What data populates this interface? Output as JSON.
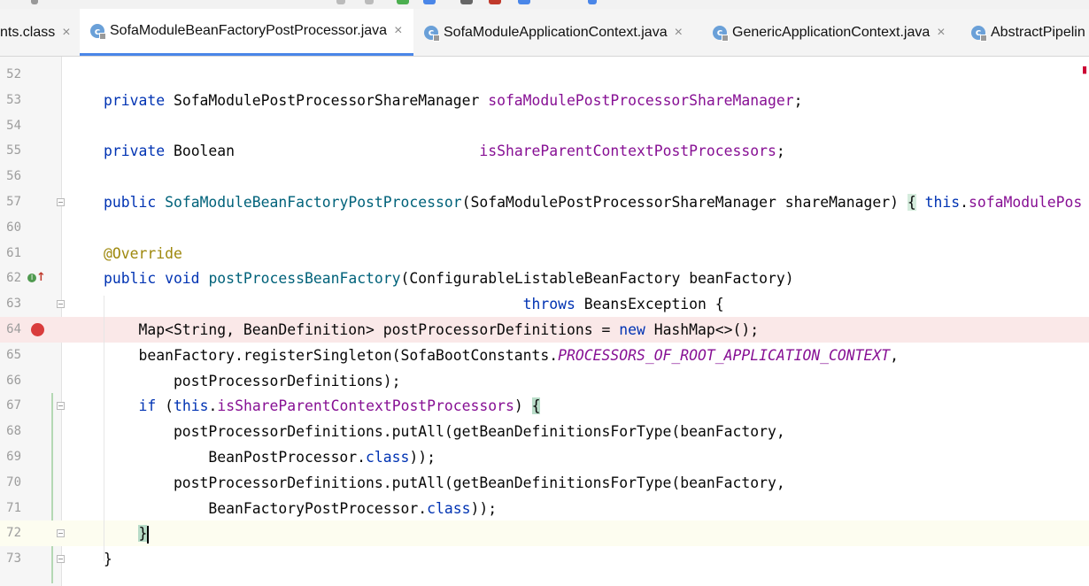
{
  "tabs": [
    {
      "label": "nts.class",
      "active": false,
      "has_icon": false
    },
    {
      "label": "SofaModuleBeanFactoryPostProcessor.java",
      "active": true,
      "has_icon": true
    },
    {
      "label": "SofaModuleApplicationContext.java",
      "active": false,
      "has_icon": true
    },
    {
      "label": "GenericApplicationContext.java",
      "active": false,
      "has_icon": true
    },
    {
      "label": "AbstractPipelin",
      "active": false,
      "has_icon": true
    }
  ],
  "tab_close_glyph": "×",
  "tab_icon_letter": "c",
  "lines": [
    {
      "num": "52",
      "tokens": []
    },
    {
      "num": "53",
      "tokens": [
        [
          "kw",
          "private"
        ],
        [
          "",
          "SofaModulePostProcessorShareManager "
        ],
        [
          "fld",
          "sofaModulePostProcessorShareManager"
        ],
        [
          "",
          ";"
        ]
      ]
    },
    {
      "num": "54",
      "tokens": []
    },
    {
      "num": "55",
      "tokens": [
        [
          "kw",
          "private"
        ],
        [
          "",
          "Boolean                            "
        ],
        [
          "fld",
          "isShareParentContextPostProcessors"
        ],
        [
          "",
          ";"
        ]
      ]
    },
    {
      "num": "56",
      "tokens": []
    },
    {
      "num": "57",
      "tokens": [
        [
          "kw",
          "public"
        ],
        [
          "mth",
          "SofaModuleBeanFactoryPostProcessor"
        ],
        [
          "",
          "(SofaModulePostProcessorShareManager shareManager) "
        ],
        [
          "brace",
          "{"
        ],
        [
          "",
          " "
        ],
        [
          "kw",
          "this"
        ],
        [
          "",
          "."
        ],
        [
          "fld",
          "sofaModulePos"
        ]
      ]
    },
    {
      "num": "60",
      "tokens": []
    },
    {
      "num": "61",
      "tokens": [
        [
          "anno",
          "@Override"
        ]
      ]
    },
    {
      "num": "62",
      "tokens": [
        [
          "kw",
          "public void"
        ],
        [
          "mth",
          "postProcessBeanFactory"
        ],
        [
          "",
          "(ConfigurableListableBeanFactory beanFactory)"
        ]
      ]
    },
    {
      "num": "63",
      "tokens": [
        [
          "",
          "                                                "
        ],
        [
          "kw",
          "throws"
        ],
        [
          "",
          " BeansException {"
        ]
      ]
    },
    {
      "num": "64",
      "tokens": [
        [
          "",
          "    Map<String, BeanDefinition> postProcessorDefinitions = "
        ],
        [
          "kw",
          "new"
        ],
        [
          "",
          " HashMap<>();"
        ]
      ]
    },
    {
      "num": "65",
      "tokens": [
        [
          "",
          "    beanFactory.registerSingleton(SofaBootConstants."
        ],
        [
          "stat",
          "PROCESSORS_OF_ROOT_APPLICATION_CONTEXT"
        ],
        [
          "",
          ","
        ]
      ]
    },
    {
      "num": "66",
      "tokens": [
        [
          "",
          "        postProcessorDefinitions);"
        ]
      ]
    },
    {
      "num": "67",
      "tokens": [
        [
          "",
          "    "
        ],
        [
          "kw",
          "if"
        ],
        [
          "",
          " ("
        ],
        [
          "kw",
          "this"
        ],
        [
          "",
          "."
        ],
        [
          "fld",
          "isShareParentContextPostProcessors"
        ],
        [
          "",
          ") "
        ],
        [
          "brace2",
          "{"
        ]
      ]
    },
    {
      "num": "68",
      "tokens": [
        [
          "",
          "        postProcessorDefinitions.putAll(getBeanDefinitionsForType(beanFactory,"
        ]
      ]
    },
    {
      "num": "69",
      "tokens": [
        [
          "",
          "            BeanPostProcessor."
        ],
        [
          "kw",
          "class"
        ],
        [
          "",
          "));"
        ]
      ]
    },
    {
      "num": "70",
      "tokens": [
        [
          "",
          "        postProcessorDefinitions.putAll(getBeanDefinitionsForType(beanFactory,"
        ]
      ]
    },
    {
      "num": "71",
      "tokens": [
        [
          "",
          "            BeanFactoryPostProcessor."
        ],
        [
          "kw",
          "class"
        ],
        [
          "",
          "));"
        ]
      ]
    },
    {
      "num": "72",
      "tokens": [
        [
          "",
          "    "
        ],
        [
          "brace2",
          "}"
        ],
        [
          "caret",
          ""
        ]
      ]
    },
    {
      "num": "73",
      "tokens": [
        [
          "",
          "}"
        ]
      ]
    }
  ],
  "colors": {
    "keyword": "#0033b3",
    "field": "#871094",
    "annotation": "#9e880d",
    "method": "#00627a",
    "breakpoint": "#d93c3c",
    "tab_underline": "#4a86e8"
  }
}
